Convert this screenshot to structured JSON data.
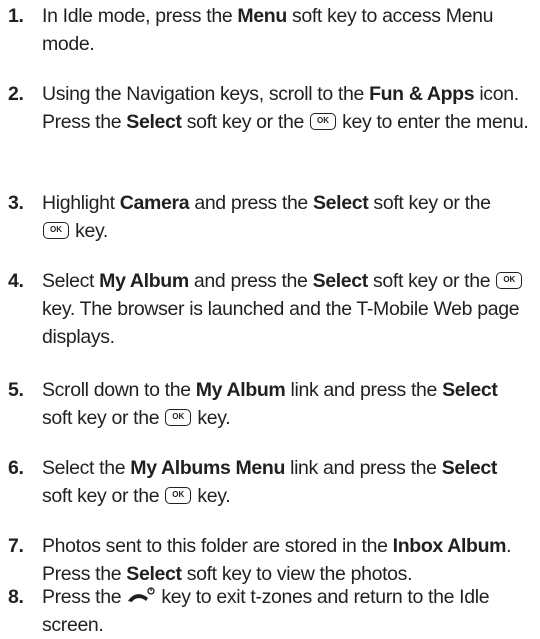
{
  "ok_key_label": "OK",
  "steps": [
    {
      "number": "1.",
      "parts": [
        {
          "t": "In Idle mode, press the "
        },
        {
          "t": "Menu",
          "b": true
        },
        {
          "t": " soft key to access Menu mode."
        }
      ]
    },
    {
      "number": "2.",
      "parts": [
        {
          "t": "Using the Navigation keys, scroll to the "
        },
        {
          "t": "Fun & Apps",
          "b": true
        },
        {
          "t": " icon. Press the "
        },
        {
          "t": "Select",
          "b": true
        },
        {
          "t": " soft key or the "
        },
        {
          "k": "ok"
        },
        {
          "t": " key to enter the menu."
        }
      ]
    },
    {
      "number": "3.",
      "parts": [
        {
          "t": "Highlight "
        },
        {
          "t": "Camera",
          "b": true
        },
        {
          "t": " and press the "
        },
        {
          "t": "Select",
          "b": true
        },
        {
          "t": " soft key or the "
        },
        {
          "k": "ok"
        },
        {
          "t": " key."
        }
      ]
    },
    {
      "number": "4.",
      "parts": [
        {
          "t": "Select "
        },
        {
          "t": "My Album",
          "b": true
        },
        {
          "t": " and press the "
        },
        {
          "t": "Select",
          "b": true
        },
        {
          "t": " soft key or the "
        },
        {
          "k": "ok"
        },
        {
          "t": " key. The browser is launched and the T-Mobile Web page displays."
        }
      ]
    },
    {
      "number": "5.",
      "parts": [
        {
          "t": "Scroll down to the "
        },
        {
          "t": "My Album",
          "b": true
        },
        {
          "t": " link and press the "
        },
        {
          "t": "Select",
          "b": true
        },
        {
          "t": " soft key or the "
        },
        {
          "k": "ok"
        },
        {
          "t": " key."
        }
      ]
    },
    {
      "number": "6.",
      "parts": [
        {
          "t": "Select the "
        },
        {
          "t": "My Albums Menu",
          "b": true
        },
        {
          "t": " link and press the "
        },
        {
          "t": "Select",
          "b": true
        },
        {
          "t": " soft key or the "
        },
        {
          "k": "ok"
        },
        {
          "t": " key."
        }
      ]
    },
    {
      "number": "7.",
      "parts": [
        {
          "t": "Photos sent to this folder are stored in the "
        },
        {
          "t": "Inbox Album",
          "b": true
        },
        {
          "t": ". Press the "
        },
        {
          "t": "Select",
          "b": true
        },
        {
          "t": " soft key to view the photos."
        }
      ]
    },
    {
      "number": "8.",
      "parts": [
        {
          "t": "Press the "
        },
        {
          "k": "end"
        },
        {
          "t": " key to exit t-zones and return to the Idle screen."
        }
      ]
    }
  ]
}
